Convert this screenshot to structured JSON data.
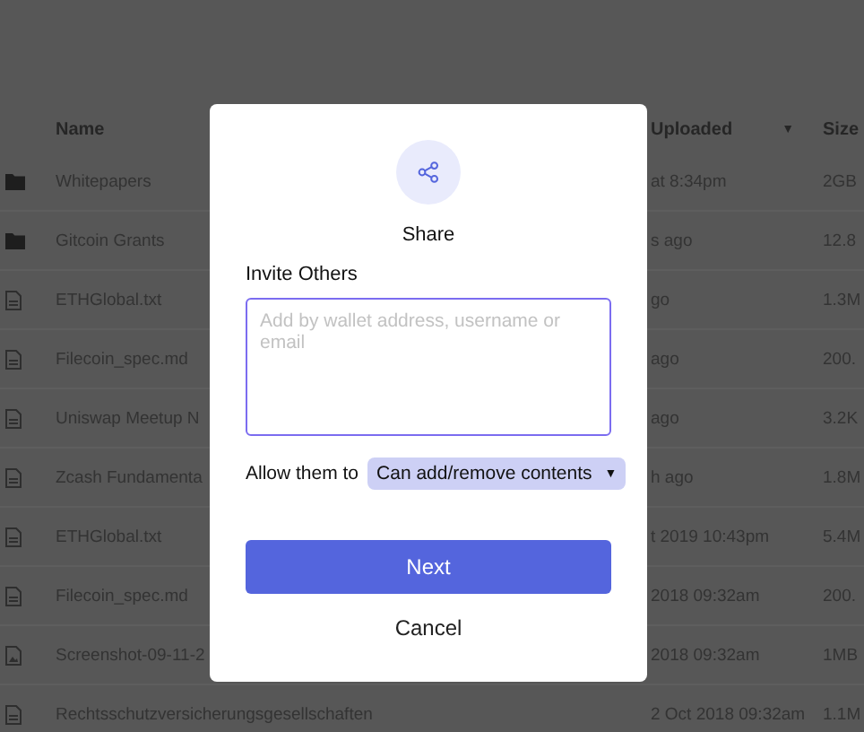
{
  "table": {
    "columns": [
      {
        "label": "Name"
      },
      {
        "label": "Uploaded",
        "sort_icon": "▼"
      },
      {
        "label": "Size"
      }
    ],
    "rows": [
      {
        "kind": "folder",
        "name": "Whitepapers",
        "uploaded": "at 8:34pm",
        "size": "2GB"
      },
      {
        "kind": "folder",
        "name": "Gitcoin Grants",
        "uploaded": "s ago",
        "size": "12.8"
      },
      {
        "kind": "file",
        "name": "ETHGlobal.txt",
        "uploaded": "go",
        "size": "1.3M"
      },
      {
        "kind": "file",
        "name": "Filecoin_spec.md",
        "uploaded": "ago",
        "size": "200."
      },
      {
        "kind": "file",
        "name": "Uniswap Meetup N",
        "uploaded": "ago",
        "size": "3.2K"
      },
      {
        "kind": "file",
        "name": "Zcash Fundamenta",
        "uploaded": "h ago",
        "size": "1.8M"
      },
      {
        "kind": "file",
        "name": "ETHGlobal.txt",
        "uploaded": "t 2019 10:43pm",
        "size": "5.4M"
      },
      {
        "kind": "file",
        "name": "Filecoin_spec.md",
        "uploaded": "2018 09:32am",
        "size": "200."
      },
      {
        "kind": "image",
        "name": "Screenshot-09-11-2",
        "uploaded": "2018 09:32am",
        "size": "1MB"
      },
      {
        "kind": "file",
        "name": "Rechtsschutzversicherungsgesellschaften",
        "uploaded": "2 Oct 2018 09:32am",
        "size": "1.1M"
      }
    ]
  },
  "dialog": {
    "title": "Share",
    "invite_label": "Invite Others",
    "invite_field": {
      "placeholder": "Add by wallet address, username or email"
    },
    "permission_label": "Allow them to",
    "permission_select": {
      "value": "Can add/remove contents",
      "caret": "▼"
    },
    "buttons": [
      {
        "label": "Next",
        "kind": "primary"
      },
      {
        "label": "Cancel",
        "kind": "link"
      }
    ]
  }
}
